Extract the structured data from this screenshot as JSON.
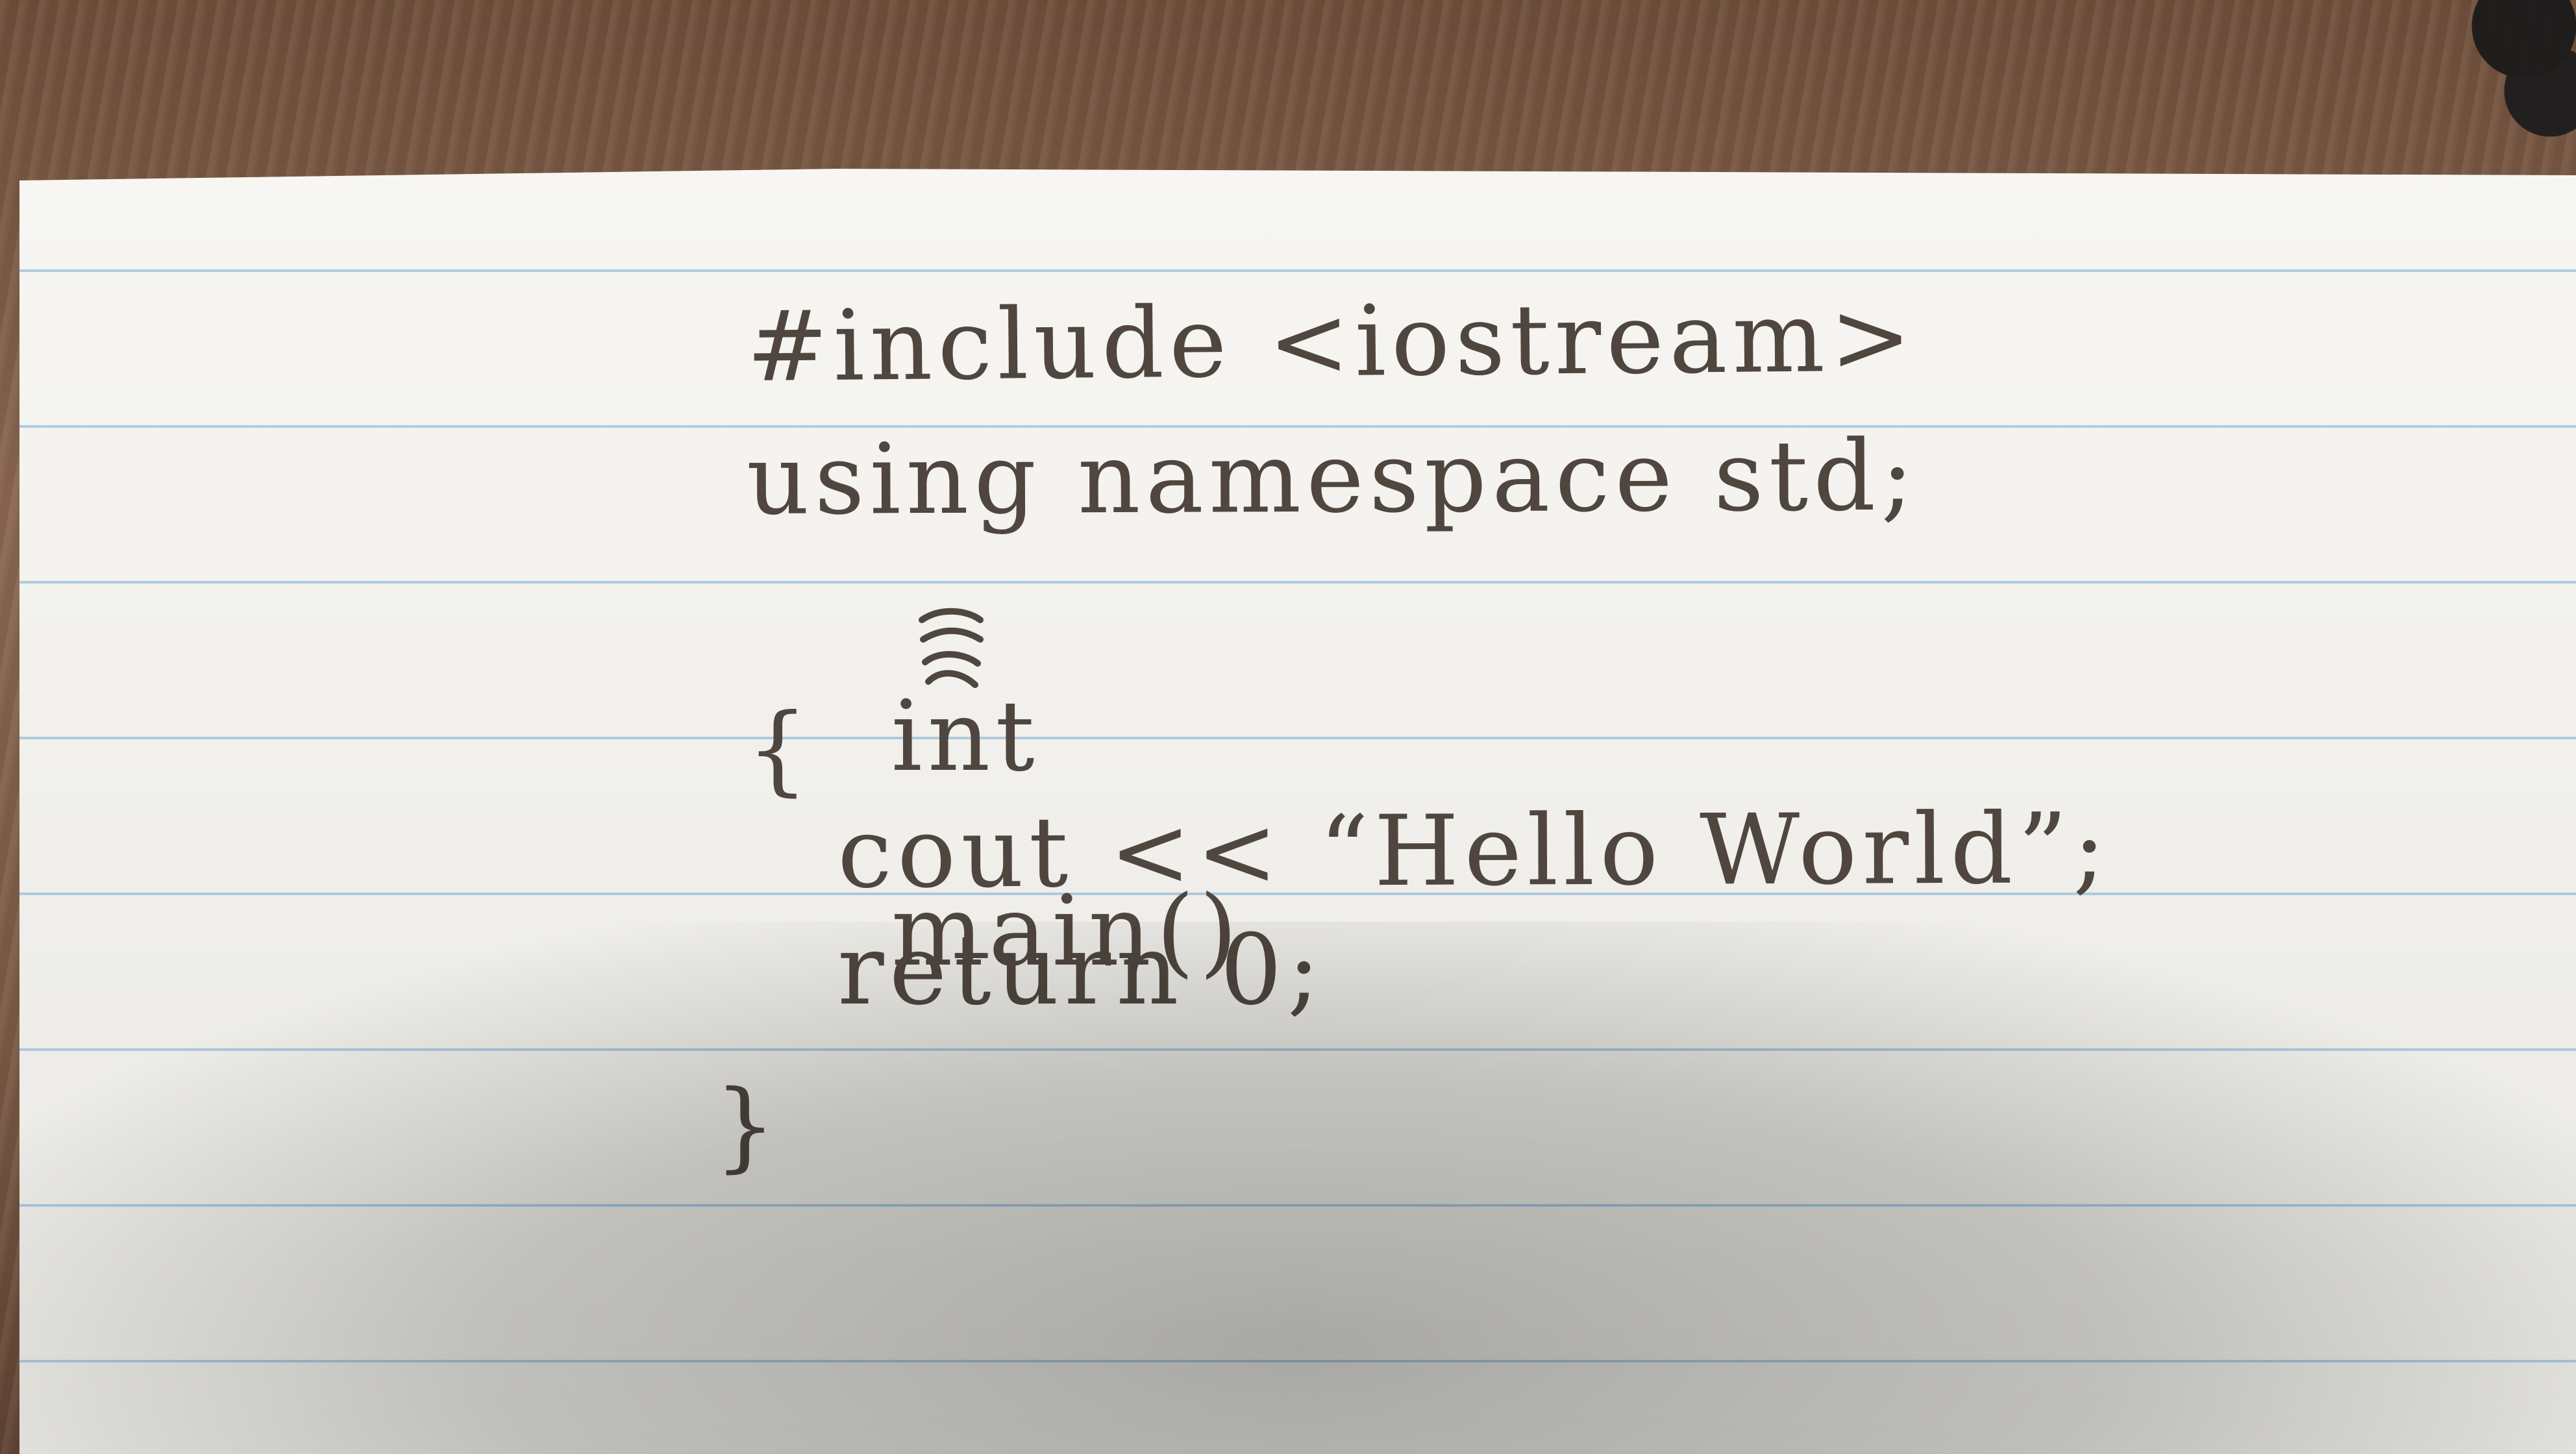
{
  "image": {
    "code_lines": [
      "#include <iostream>",
      "using namespace std;",
      "int",
      "main()",
      "{",
      "cout << “Hello World”;",
      "return 0;",
      "}"
    ]
  }
}
